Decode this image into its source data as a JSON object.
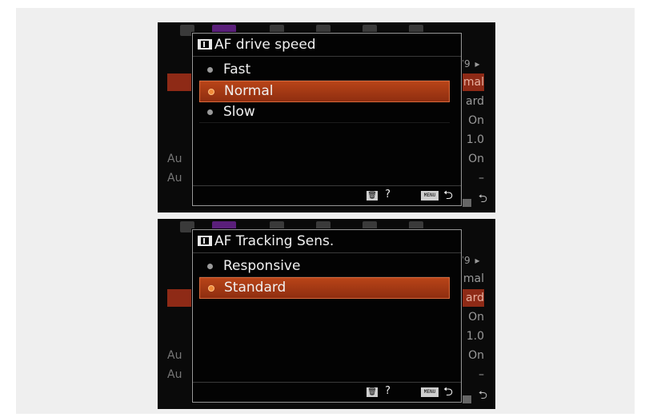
{
  "colors": {
    "highlight": "#a63a14",
    "background": "#0a0a0a",
    "frame": "#efefef"
  },
  "screens": [
    {
      "title": "AF drive speed",
      "options": [
        {
          "label": "Fast",
          "selected": false
        },
        {
          "label": "Normal",
          "selected": true
        },
        {
          "label": "Slow",
          "selected": false
        }
      ],
      "background_menu": {
        "page": "/9 ▸",
        "rows": [
          {
            "label": "",
            "value": "mal",
            "highlighted": true
          },
          {
            "label": "",
            "value": "ard"
          },
          {
            "label": "",
            "value": "On"
          },
          {
            "label": "",
            "value": "1.0"
          },
          {
            "label": "Au",
            "value": "On"
          },
          {
            "label": "Au",
            "value": "–"
          }
        ]
      },
      "footer": {
        "help": "?",
        "menu": "MENU",
        "trash_icon": "trash-icon",
        "return_icon": "return-icon"
      }
    },
    {
      "title": "AF Tracking Sens.",
      "options": [
        {
          "label": "Responsive",
          "selected": false
        },
        {
          "label": "Standard",
          "selected": true
        }
      ],
      "background_menu": {
        "page": "/9 ▸",
        "rows": [
          {
            "label": "",
            "value": "mal"
          },
          {
            "label": "",
            "value": "ard",
            "highlighted": true
          },
          {
            "label": "",
            "value": "On"
          },
          {
            "label": "",
            "value": "1.0"
          },
          {
            "label": "Au",
            "value": "On"
          },
          {
            "label": "Au",
            "value": "–"
          }
        ]
      },
      "footer": {
        "help": "?",
        "menu": "MENU",
        "trash_icon": "trash-icon",
        "return_icon": "return-icon"
      }
    }
  ]
}
